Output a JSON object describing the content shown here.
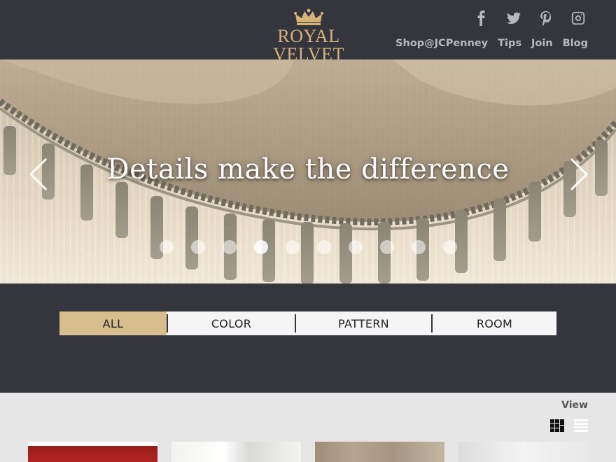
{
  "brand": {
    "logo_text": "ROYAL VELVET",
    "logo_color": "#d4b27a"
  },
  "social": [
    {
      "name": "facebook",
      "icon": "facebook-icon"
    },
    {
      "name": "twitter",
      "icon": "twitter-icon"
    },
    {
      "name": "pinterest",
      "icon": "pinterest-icon"
    },
    {
      "name": "instagram",
      "icon": "instagram-icon"
    }
  ],
  "nav": {
    "shop": "Shop@JCPenney",
    "tips": "Tips",
    "join": "Join",
    "blog": "Blog"
  },
  "hero": {
    "title": "Details make the difference",
    "slide_count": 10,
    "active_slide": 4
  },
  "filter": {
    "tabs": [
      "ALL",
      "COLOR",
      "PATTERN",
      "ROOM"
    ],
    "active": "ALL",
    "accent": "#d8be8f"
  },
  "gallery": {
    "view_label": "View",
    "view_modes": [
      "grid-icon",
      "list-icon"
    ]
  },
  "colors": {
    "background": "#34353d",
    "nav_text": "#b7b8bd",
    "gallery_bg": "#e6e6e6"
  }
}
